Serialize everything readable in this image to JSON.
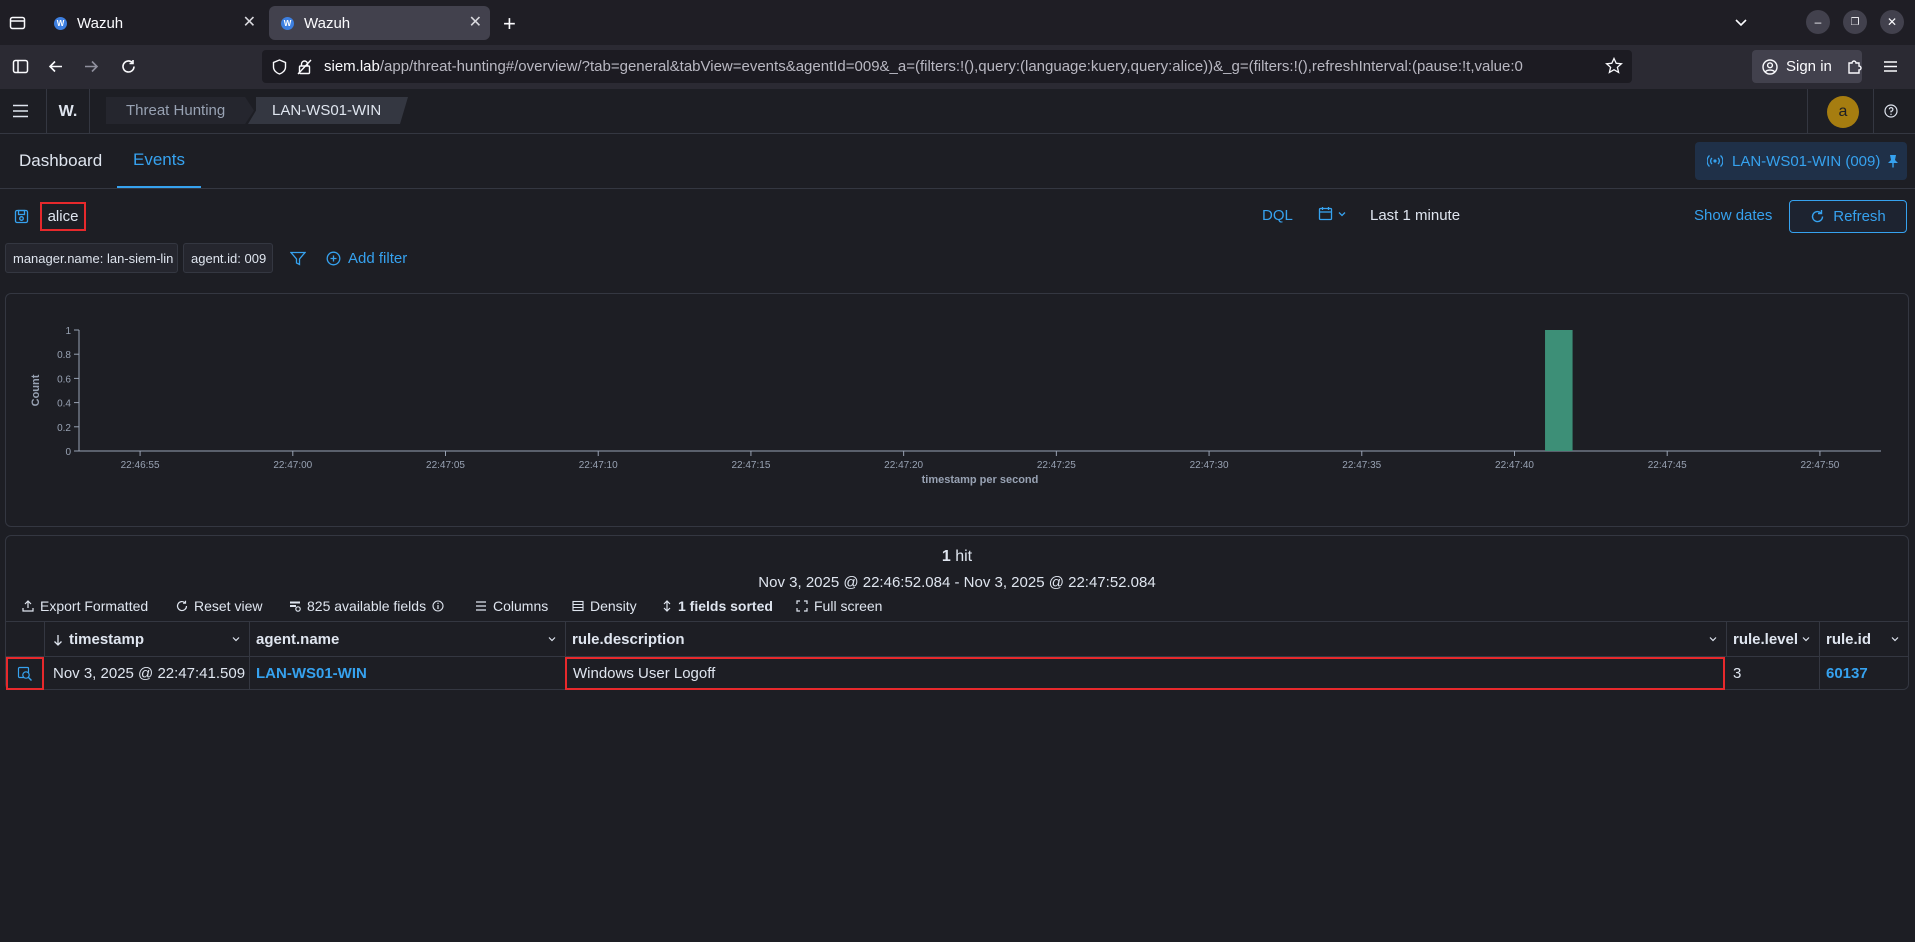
{
  "browser": {
    "tabs": [
      {
        "title": "Wazuh",
        "favicon": "W"
      },
      {
        "title": "Wazuh",
        "favicon": "W"
      }
    ],
    "url_host": "siem.lab",
    "url_path": "/app/threat-hunting#/overview/?tab=general&tabView=events&agentId=009&_a=(filters:!(),query:(language:kuery,query:alice))&_g=(filters:!(),refreshInterval:(pause:!t,value:0",
    "sign_in": "Sign in"
  },
  "header": {
    "logo": "W.",
    "breadcrumbs": [
      "Threat Hunting",
      "LAN-WS01-WIN"
    ],
    "avatar": "a"
  },
  "view_tabs": {
    "dashboard": "Dashboard",
    "events": "Events",
    "active": "Events",
    "agent_pin": "LAN-WS01-WIN (009)"
  },
  "query": {
    "text": "alice",
    "language": "DQL",
    "time_range": "Last 1 minute",
    "show_dates": "Show dates",
    "refresh": "Refresh"
  },
  "filters": {
    "pills": [
      "manager.name: lan-siem-lin",
      "agent.id: 009"
    ],
    "add_filter": "Add filter"
  },
  "chart_data": {
    "type": "bar",
    "xlabel": "timestamp per second",
    "ylabel": "Count",
    "ylim": [
      0,
      1
    ],
    "y_ticks": [
      "0",
      "0.2",
      "0.4",
      "0.6",
      "0.8",
      "1"
    ],
    "x_ticks": [
      "22:46:55",
      "22:47:00",
      "22:47:05",
      "22:47:10",
      "22:47:15",
      "22:47:20",
      "22:47:25",
      "22:47:30",
      "22:47:35",
      "22:47:40",
      "22:47:45",
      "22:47:50"
    ],
    "x_range": [
      "22:46:53",
      "22:47:52"
    ],
    "bars": [
      {
        "x": "22:47:41",
        "value": 1
      }
    ],
    "bar_color": "#3d8f77"
  },
  "results": {
    "hits_count": "1",
    "hits_label": "hit",
    "range": "Nov 3, 2025 @ 22:46:52.084 - Nov 3, 2025 @ 22:47:52.084",
    "toolbar": {
      "export": "Export Formatted",
      "reset": "Reset view",
      "fields": "825 available fields",
      "columns": "Columns",
      "density": "Density",
      "sorted": "1 fields sorted",
      "fullscreen": "Full screen"
    },
    "columns": [
      "timestamp",
      "agent.name",
      "rule.description",
      "rule.level",
      "rule.id"
    ],
    "rows": [
      {
        "timestamp": "Nov 3, 2025 @ 22:47:41.509",
        "agent_name": "LAN-WS01-WIN",
        "rule_description": "Windows User Logoff",
        "rule_level": "3",
        "rule_id": "60137"
      }
    ]
  },
  "colors": {
    "accent": "#36a2ef",
    "highlight": "#e7292c",
    "background": "#1d1e24"
  }
}
